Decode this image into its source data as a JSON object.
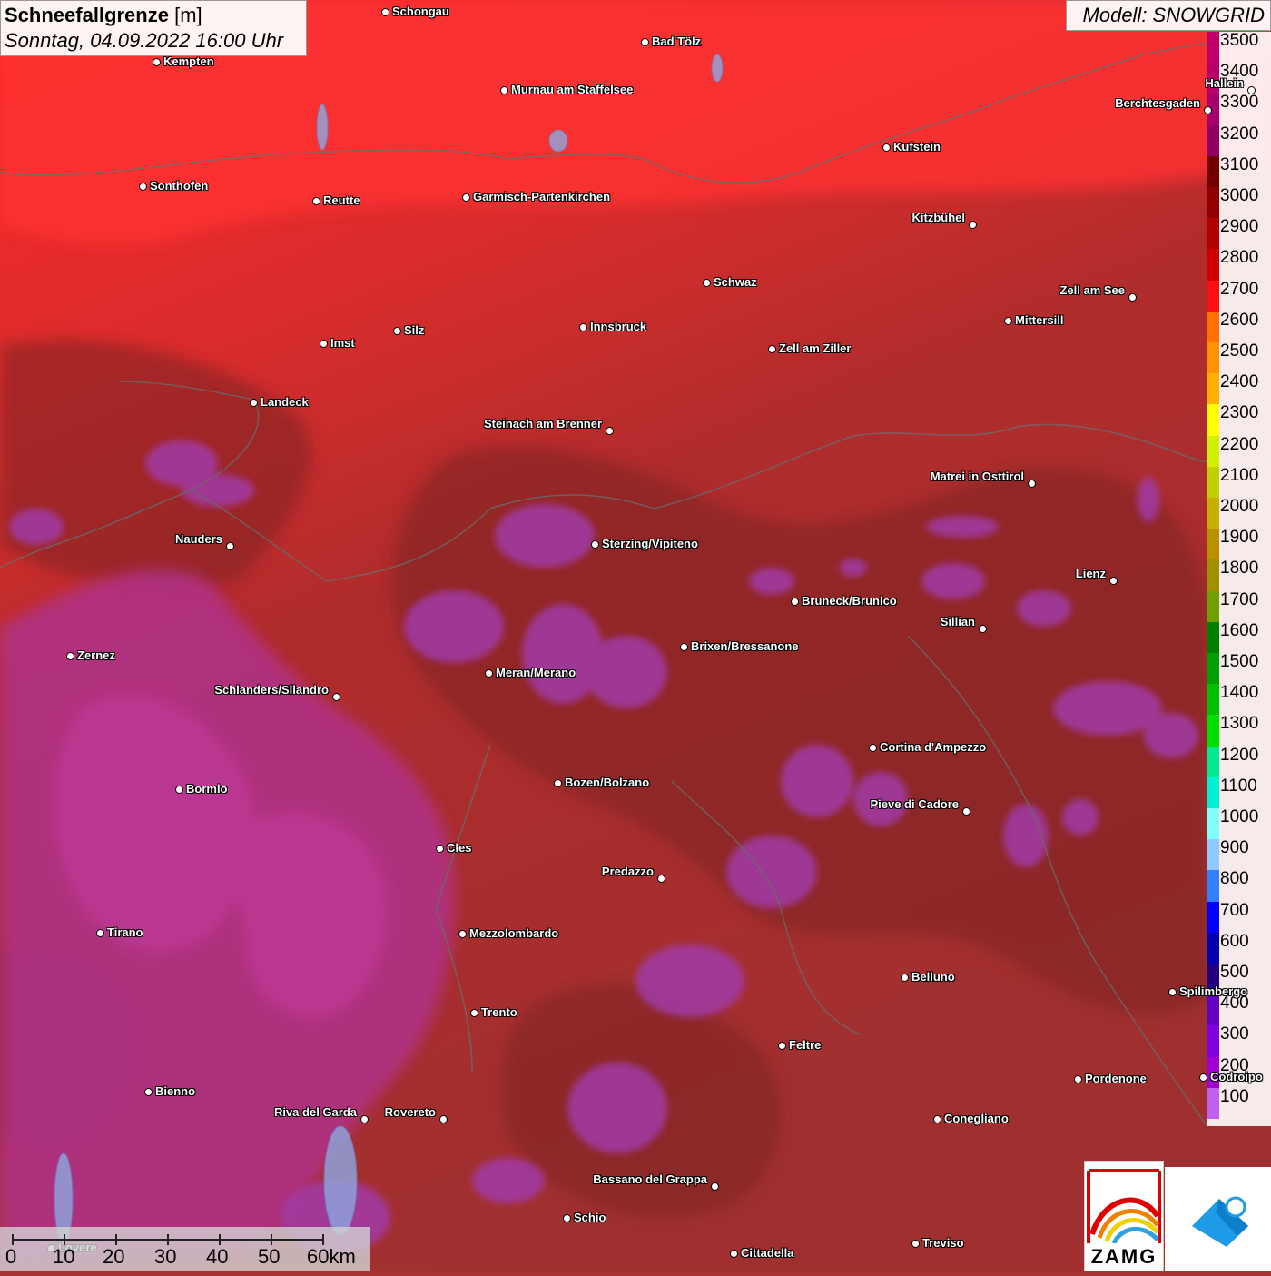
{
  "title": {
    "main": "Schneefallgrenze",
    "unit": "[m]",
    "subtitle": "Sonntag, 04.09.2022 16:00 Uhr"
  },
  "model": "Modell: SNOWGRID",
  "legend": {
    "labels": [
      "3500",
      "3400",
      "3300",
      "3200",
      "3100",
      "3000",
      "2900",
      "2800",
      "2700",
      "2600",
      "2500",
      "2400",
      "2300",
      "2200",
      "2100",
      "2000",
      "1900",
      "1800",
      "1700",
      "1600",
      "1500",
      "1400",
      "1300",
      "1200",
      "1100",
      "1000",
      "900",
      "800",
      "700",
      "600",
      "500",
      "400",
      "300",
      "200",
      "100"
    ],
    "colors": [
      "#c0006a",
      "#b8006a",
      "#a8006a",
      "#900060",
      "#700000",
      "#900000",
      "#b00000",
      "#d00000",
      "#ff1010",
      "#ff7000",
      "#ff9000",
      "#ffb000",
      "#ffff00",
      "#d0f000",
      "#c0d000",
      "#c8b000",
      "#b89000",
      "#a09000",
      "#70a000",
      "#008000",
      "#00a000",
      "#00c000",
      "#00e000",
      "#00e890",
      "#00f0d0",
      "#80ffff",
      "#90c8ff",
      "#3080ff",
      "#0000ff",
      "#0000b0",
      "#200080",
      "#6000c0",
      "#8000e0",
      "#a000d0",
      "#c060f0"
    ]
  },
  "cities": [
    {
      "name": "Schongau"
    },
    {
      "name": "Bad Tölz"
    },
    {
      "name": "Kempten"
    },
    {
      "name": "Murnau am Staffelsee"
    },
    {
      "name": "Berchtesgaden"
    },
    {
      "name": "Hallein"
    },
    {
      "name": "Kufstein"
    },
    {
      "name": "Sonthofen"
    },
    {
      "name": "Reutte"
    },
    {
      "name": "Garmisch-Partenkirchen"
    },
    {
      "name": "Kitzbühel"
    },
    {
      "name": "Schwaz"
    },
    {
      "name": "Zell am See"
    },
    {
      "name": "Mittersill"
    },
    {
      "name": "Innsbruck"
    },
    {
      "name": "Imst"
    },
    {
      "name": "Silz"
    },
    {
      "name": "Zell am Ziller"
    },
    {
      "name": "Landeck"
    },
    {
      "name": "Steinach am Brenner"
    },
    {
      "name": "Matrei in Osttirol"
    },
    {
      "name": "Nauders"
    },
    {
      "name": "Sterzing/Vipiteno"
    },
    {
      "name": "Lienz"
    },
    {
      "name": "Bruneck/Brunico"
    },
    {
      "name": "Sillian"
    },
    {
      "name": "Zernez"
    },
    {
      "name": "Brixen/Bressanone"
    },
    {
      "name": "Meran/Merano"
    },
    {
      "name": "Schlanders/Silandro"
    },
    {
      "name": "Cortina d'Ampezzo"
    },
    {
      "name": "Bozen/Bolzano"
    },
    {
      "name": "Bormio"
    },
    {
      "name": "Pieve di Cadore"
    },
    {
      "name": "Cles"
    },
    {
      "name": "Predazzo"
    },
    {
      "name": "Tirano"
    },
    {
      "name": "Mezzolombardo"
    },
    {
      "name": "Belluno"
    },
    {
      "name": "Spilimbergo"
    },
    {
      "name": "Trento"
    },
    {
      "name": "Feltre"
    },
    {
      "name": "Pordenone"
    },
    {
      "name": "Codroipo"
    },
    {
      "name": "Bienno"
    },
    {
      "name": "Riva del Garda"
    },
    {
      "name": "Rovereto"
    },
    {
      "name": "Conegliano"
    },
    {
      "name": "Bassano del Grappa"
    },
    {
      "name": "Schio"
    },
    {
      "name": "Lovere"
    },
    {
      "name": "Treviso"
    },
    {
      "name": "Cittadella"
    }
  ],
  "scale": {
    "labels": [
      "0",
      "10",
      "20",
      "30",
      "40",
      "50",
      "60km"
    ]
  },
  "logo": {
    "text": "ZAMG"
  }
}
